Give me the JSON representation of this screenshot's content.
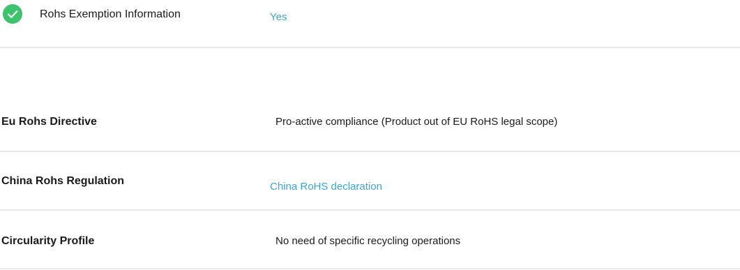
{
  "exemption": {
    "icon": "check-circle-icon",
    "label": "Rohs Exemption Information",
    "value": "Yes"
  },
  "rows": [
    {
      "label": "Eu Rohs Directive",
      "value": "Pro-active compliance (Product out of EU RoHS legal scope)",
      "is_link": false
    },
    {
      "label": "China Rohs Regulation",
      "value": "China RoHS declaration",
      "is_link": true
    },
    {
      "label": "Circularity Profile",
      "value": "No need of specific recycling operations",
      "is_link": false
    }
  ],
  "colors": {
    "check_green": "#3cc36b",
    "link_blue": "#3aa6d8",
    "divider": "#e8e8e8"
  }
}
